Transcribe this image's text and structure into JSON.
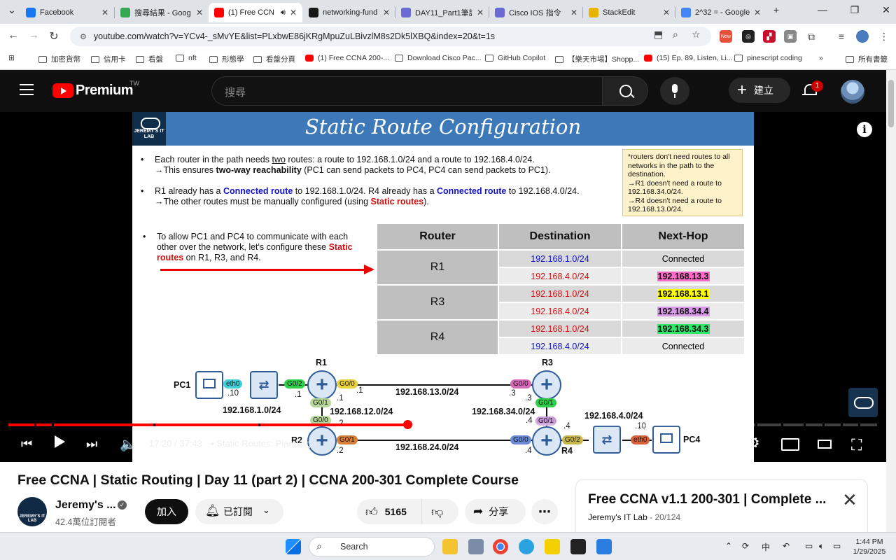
{
  "browser": {
    "tabs": [
      {
        "title": "Facebook",
        "icon": "facebook-icon",
        "color": "#1877f2"
      },
      {
        "title": "搜尋結果 - Goog",
        "icon": "google-drive-icon",
        "color": "#34a853"
      },
      {
        "title": "(1) Free CCN",
        "icon": "youtube-icon",
        "color": "#ff0000"
      },
      {
        "title": "networking-fund",
        "icon": "github-icon",
        "color": "#181717"
      },
      {
        "title": "DAY11_Part1筆記",
        "icon": "notion-icon",
        "color": "#6b6bd6"
      },
      {
        "title": "Cisco IOS 指令",
        "icon": "notion-icon",
        "color": "#6b6bd6"
      },
      {
        "title": "StackEdit",
        "icon": "stackedit-icon",
        "color": "#e8b400"
      },
      {
        "title": "2^32 = - Google",
        "icon": "google-icon",
        "color": "#4285f4"
      }
    ],
    "url": "youtube.com/watch?v=YCv4-_sMvYE&list=PLxbwE86jKRgMpuZuLBivzlM8s2Dk5lXBQ&index=20&t=1s",
    "bookmarks": [
      {
        "label": "加密貨幣",
        "icon": "folder-icon"
      },
      {
        "label": "信用卡",
        "icon": "folder-icon"
      },
      {
        "label": "看盤",
        "icon": "folder-icon"
      },
      {
        "label": "nft",
        "icon": "folder-icon"
      },
      {
        "label": "形態學",
        "icon": "folder-icon"
      },
      {
        "label": "看盤分頁",
        "icon": "folder-icon"
      },
      {
        "label": "(1) Free CCNA 200-...",
        "icon": "youtube-icon"
      },
      {
        "label": "Download Cisco Pac...",
        "icon": "cisco-icon"
      },
      {
        "label": "GitHub Copilot",
        "icon": "github-icon"
      },
      {
        "label": "【樂天市場】Shopp...",
        "icon": "rakuten-icon"
      },
      {
        "label": "(15) Ep. 89, Listen, Li...",
        "icon": "youtube-icon"
      },
      {
        "label": "pinescript coding",
        "icon": "folder-icon"
      }
    ],
    "all_bookmarks": "所有書籤",
    "new_badge": "New"
  },
  "youtube": {
    "brand": "Premium",
    "region": "TW",
    "search_placeholder": "搜尋",
    "create_label": "建立",
    "notif_count": "1"
  },
  "slide": {
    "logo_text": "JEREMY'S IT LAB",
    "title": "Static Route Configuration",
    "bullet1_a": "Each router in the path needs ",
    "bullet1_u": "two",
    "bullet1_b": " routes: a route to 192.168.1.0/24 and a route to 192.168.4.0/24.",
    "bullet1_sub_a": "→This ensures ",
    "bullet1_sub_b": "two-way reachability",
    "bullet1_sub_c": " (PC1 can send packets to PC4, PC4 can send packets to PC1).",
    "bullet2_a": "R1 already has a ",
    "bullet2_b": "Connected route",
    "bullet2_c": " to 192.168.1.0/24. R4 already has a ",
    "bullet2_d": "Connected route",
    "bullet2_e": " to 192.168.4.0/24.",
    "bullet2_sub_a": "→The other routes must be manually configured (using ",
    "bullet2_sub_b": "Static routes",
    "bullet2_sub_c": ").",
    "bullet3_a": "To allow PC1 and PC4 to communicate with each other over the network, let's configure these ",
    "bullet3_b": "Static routes",
    "bullet3_c": " on R1, R3, and R4.",
    "note_lines": [
      "*routers don't need routes to all networks in the path to the destination.",
      "→R1 doesn't need a route to 192.168.34.0/24.",
      "→R4 doesn't need a route to 192.168.13.0/24."
    ],
    "table": {
      "headers": [
        "Router",
        "Destination",
        "Next-Hop"
      ],
      "routers": [
        "R1",
        "R3",
        "R4"
      ],
      "rows": [
        {
          "dest": "192.168.1.0/24",
          "dest_color": "#1010c8",
          "hop": "Connected",
          "hop_bg": ""
        },
        {
          "dest": "192.168.4.0/24",
          "dest_color": "#d01010",
          "hop": "192.168.13.3",
          "hop_bg": "#ff69c8"
        },
        {
          "dest": "192.168.1.0/24",
          "dest_color": "#d01010",
          "hop": "192.168.13.1",
          "hop_bg": "#ffff00"
        },
        {
          "dest": "192.168.4.0/24",
          "dest_color": "#d01010",
          "hop": "192.168.34.4",
          "hop_bg": "#d89ae8"
        },
        {
          "dest": "192.168.1.0/24",
          "dest_color": "#d01010",
          "hop": "192.168.34.3",
          "hop_bg": "#2ee86a"
        },
        {
          "dest": "192.168.4.0/24",
          "dest_color": "#1010c8",
          "hop": "Connected",
          "hop_bg": ""
        }
      ]
    },
    "diagram": {
      "pc1": "PC1",
      "pc4": "PC4",
      "r1": "R1",
      "r2": "R2",
      "r3": "R3",
      "r4": "R4",
      "eth0_left": "eth0",
      "eth0_right": "eth0",
      "r1_g02": "G0/2",
      "r1_g00": "G0/0",
      "r1_g01": "G0/1",
      "r3_g00": "G0/0",
      "r3_g01": "G0/1",
      "r4_g01": "G0/1",
      "r4_g00": "G0/0",
      "r4_g02": "G0/2",
      "r2_g00": "G0/0",
      "r2_g01": "G0/1",
      "net_1": "192.168.1.0/24",
      "net_13": "192.168.13.0/24",
      "net_12": "192.168.12.0/24",
      "net_34": "192.168.34.0/24",
      "net_4": "192.168.4.0/24",
      "net_24": "192.168.24.0/24",
      "ip_pc1": ".10",
      "ip_r1_g02": ".1",
      "ip_r1_g00": ".1",
      "ip_r1_g01": ".1",
      "ip_r3_g00": ".3",
      "ip_r3_g01": ".3",
      "ip_r2_top": ".2",
      "ip_r2_bot": ".2",
      "ip_r4_g01": ".4",
      "ip_r4_g02": ".4",
      "ip_r4_g00": ".4",
      "ip_pc4": ".10"
    }
  },
  "player": {
    "current_time": "17:20",
    "duration": "37:43",
    "time_display": "17:20 / 37:43",
    "chapter": "•  Static Routes: Planning",
    "chapter_arrow": "›",
    "progress_fraction": 0.4597,
    "buffered_fraction": 0.51,
    "chapter_marks": [
      0.03,
      0.05,
      0.167,
      0.288,
      0.86,
      0.89,
      0.915,
      0.937,
      0.958,
      0.978
    ]
  },
  "video": {
    "title": "Free CCNA | Static Routing | Day 11 (part 2) | CCNA 200-301 Complete Course",
    "channel": "Jeremy's ...",
    "channel_avatar_text": "JEREMY'S IT LAB",
    "verified": "✓",
    "subscribers": "42.4萬位訂閱者",
    "join": "加入",
    "subscribed": "已訂閱",
    "likes": "5165",
    "share": "分享",
    "more": "⋯"
  },
  "playlist": {
    "title": "Free CCNA v1.1 200-301 | Complete ...",
    "owner": "Jeremy's IT Lab",
    "position": " - 20/124"
  },
  "taskbar": {
    "search": "Search",
    "ime": "中",
    "time": "1:44 PM",
    "date": "1/29/2025"
  }
}
